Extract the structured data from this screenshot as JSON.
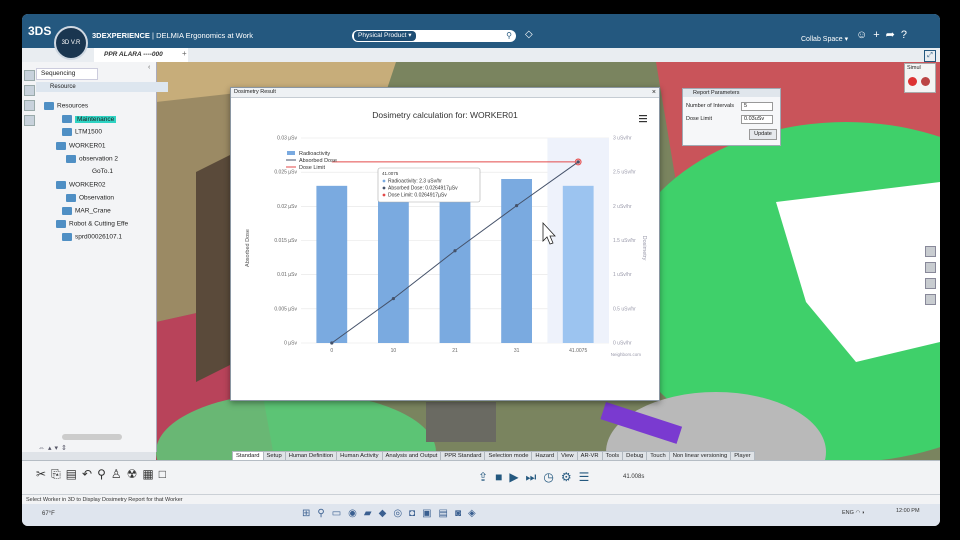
{
  "app": {
    "brand_logo": "3DS",
    "compass_label": "3D V.R",
    "title_product": "3DEXPERIENCE",
    "title_rest": "| DELMIA Ergonomics at Work",
    "search_tag": "Physical Product",
    "collab_space": "Collab Space",
    "doc_tab": "PPR ALARA ----000"
  },
  "tree": {
    "tab": "Sequencing",
    "header": "Resource",
    "items": [
      {
        "label": "Resources"
      },
      {
        "label": "Maintenance"
      },
      {
        "label": "LTM1500"
      },
      {
        "label": "WORKER01"
      },
      {
        "label": "observation 2"
      },
      {
        "label": "GoTo.1"
      },
      {
        "label": "WORKER02"
      },
      {
        "label": "Observation"
      },
      {
        "label": "MAR_Crane"
      },
      {
        "label": "Robot & Cutting Effe"
      },
      {
        "label": "sprd00026107.1"
      }
    ]
  },
  "report": {
    "title": "Report Parameters",
    "intervals_label": "Number of Intervals",
    "intervals_value": "5",
    "limit_label": "Dose Limit",
    "limit_value": "0.03uSv",
    "update_label": "Update"
  },
  "simul": {
    "label": "Simul"
  },
  "dosimetry": {
    "window_title": "Dosimetry Result",
    "tooltip": {
      "header": "41.0075",
      "radioactivity": "Radioactivity: 2.3 uSv/hr",
      "absorbed": "Absorbed Dose: 0.0264917µSv",
      "limit": "Dose Limit: 0.0264917µSv"
    }
  },
  "chart_data": {
    "type": "bar",
    "title": "Dosimetry calculation for: WORKER01",
    "categories": [
      "0",
      "10",
      "21",
      "31",
      "41.0075"
    ],
    "series": [
      {
        "name": "Radioactivity",
        "type": "bar",
        "axis": "right",
        "values": [
          2.3,
          2.3,
          2.3,
          2.4,
          2.3
        ],
        "color": "#7aaae0"
      },
      {
        "name": "Absorbed Dose",
        "type": "line",
        "axis": "left",
        "values": [
          0,
          0.0065,
          0.0135,
          0.0201,
          0.0265
        ],
        "color": "#45526a"
      },
      {
        "name": "Dose Limit",
        "type": "line",
        "axis": "left",
        "values": [
          0.0265,
          0.0265,
          0.0265,
          0.0265,
          0.0265
        ],
        "color": "#e34a4a"
      }
    ],
    "ylabel": "Absorbed Dose",
    "y2label": "Dosimetry",
    "xlabel": "Neighbors.com",
    "ylim": [
      0,
      0.03
    ],
    "y2lim": [
      0,
      3
    ],
    "yticks": [
      "0 µSv",
      "0.005 µSv",
      "0.01 µSv",
      "0.015 µSv",
      "0.02 µSv",
      "0.025 µSv",
      "0.03 µSv"
    ],
    "y2ticks": [
      "0 uSv/hr",
      "0.5 uSv/hr",
      "1 uSv/hr",
      "1.5 uSv/hr",
      "2 uSv/hr",
      "2.5 uSv/hr",
      "3 uSv/hr"
    ],
    "legend": "top-left",
    "grid": true
  },
  "bottom_tabs": [
    "Standard",
    "Setup",
    "Human Definition",
    "Human Activity",
    "Analysis and Output",
    "PPR Standard",
    "Selection mode",
    "Hazard",
    "View",
    "AR-VR",
    "Tools",
    "Debug",
    "Touch",
    "Non linear versioning",
    "Player"
  ],
  "player": {
    "time": "41.008s"
  },
  "status": "Select Worker in 3D to Display Dosimetry Report for that Worker",
  "taskbar": {
    "weather": "67°F",
    "lang": "ENG",
    "time": "12:00 PM"
  },
  "colors": {
    "brand_blue": "#24587f",
    "highlight": "#2fd3c3",
    "floor_red": "#c9545a",
    "zone_green": "#3fd06a"
  }
}
